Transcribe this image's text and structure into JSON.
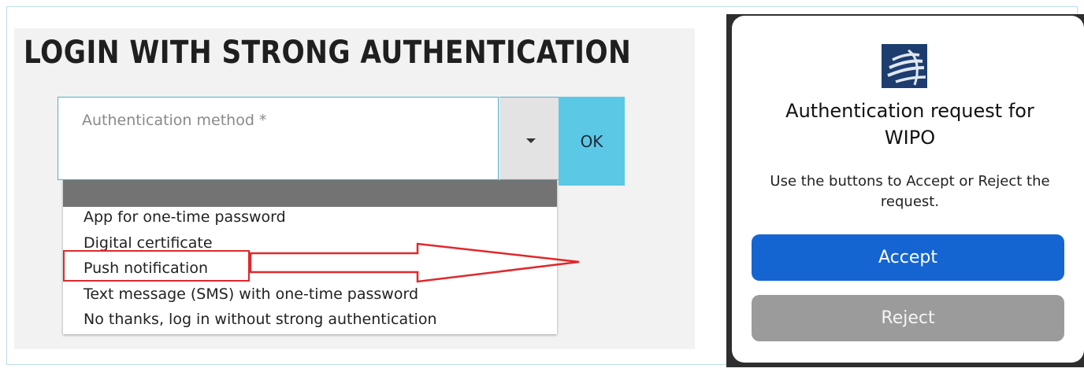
{
  "login": {
    "title": "LOGIN WITH STRONG AUTHENTICATION",
    "method_label": "Authentication method *",
    "ok_label": "OK",
    "options": [
      "App for one-time password",
      "Digital certificate",
      "Push notification",
      "Text message (SMS) with one-time password",
      "No thanks, log in without strong authentication"
    ],
    "highlighted_option": "Push notification"
  },
  "auth_request": {
    "title_line1": "Authentication request for",
    "title_line2": "WIPO",
    "message": "Use the buttons to Accept or Reject the request.",
    "accept_label": "Accept",
    "reject_label": "Reject",
    "logo_icon": "wipo-globe-logo"
  },
  "colors": {
    "accent": "#5bc8e6",
    "accept": "#1465d2",
    "reject": "#9b9b9b",
    "highlight": "#e0282c"
  }
}
